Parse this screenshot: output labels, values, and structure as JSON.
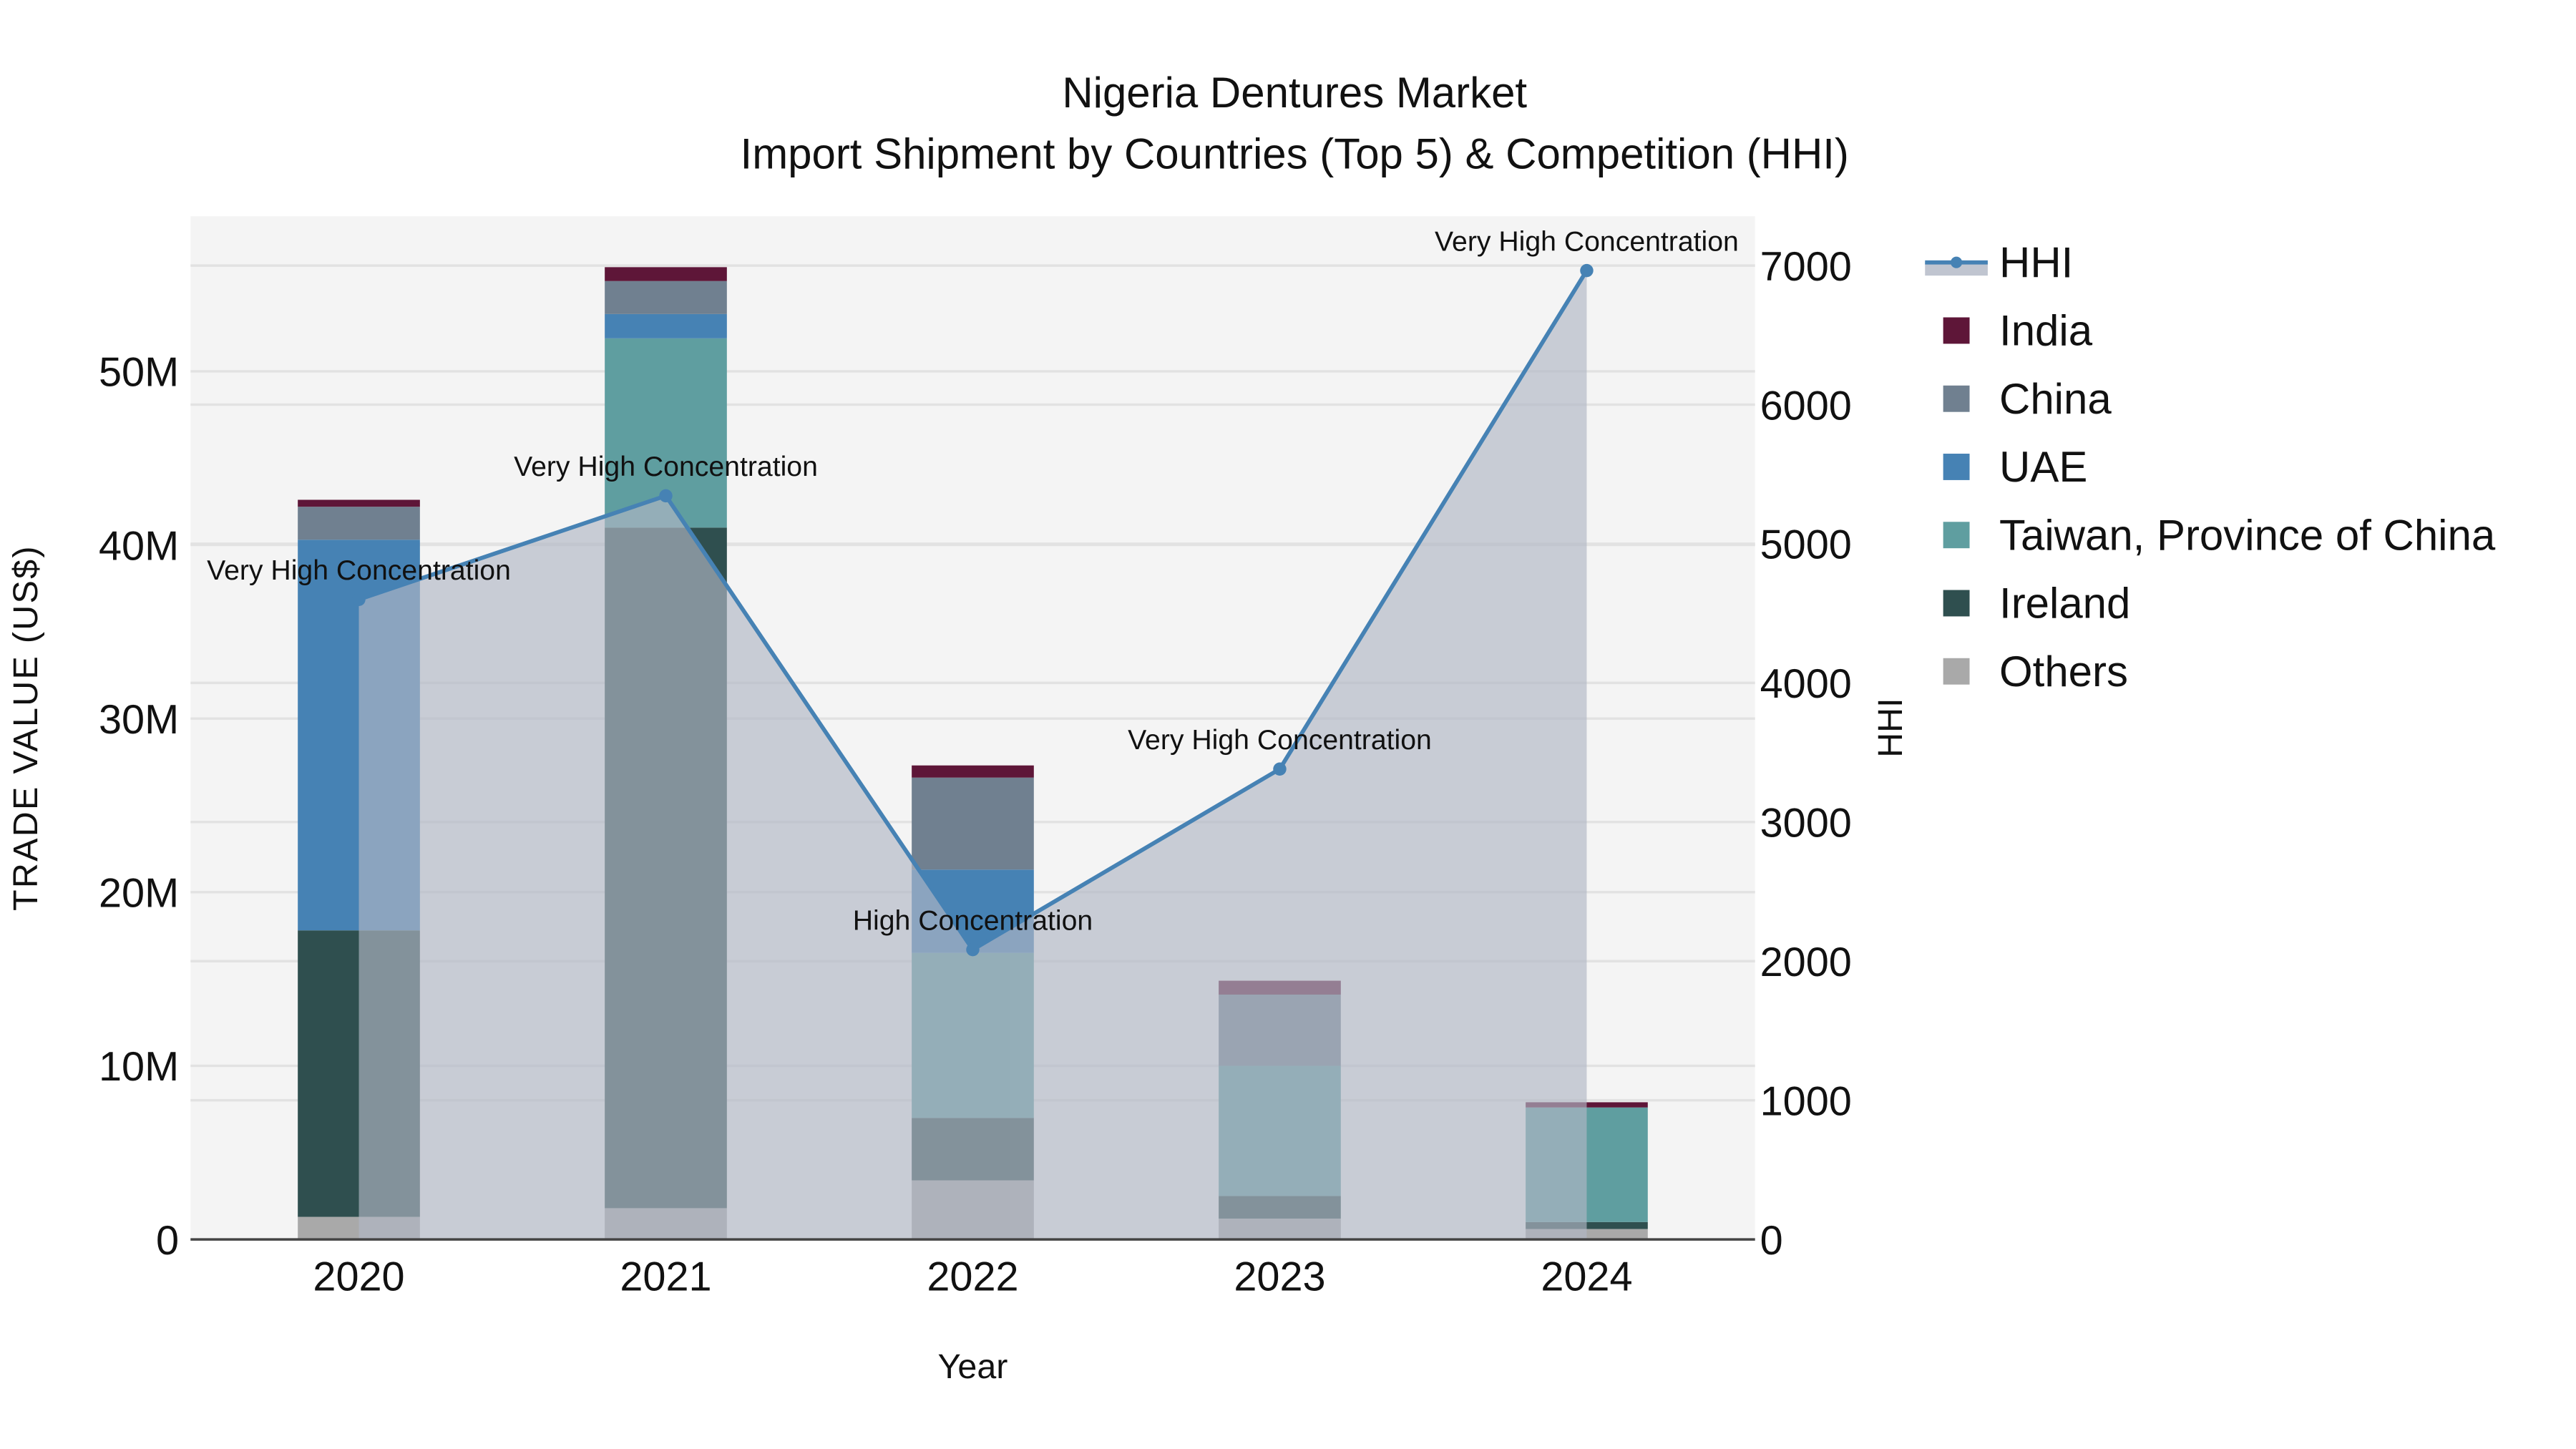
{
  "chart_data": {
    "type": "bar",
    "title": "Nigeria Dentures Market",
    "subtitle": "Import Shipment by Countries (Top 5) & Competition (HHI)",
    "xlabel": "Year",
    "ylabel": "TRADE VALUE (US$)",
    "y2label": "HHI",
    "categories": [
      "2020",
      "2021",
      "2022",
      "2023",
      "2024"
    ],
    "ylim": [
      0,
      58.8
    ],
    "y_unit": "M",
    "y_ticks": [
      0,
      10,
      20,
      30,
      40,
      50
    ],
    "y_tick_labels": [
      "0",
      "10M",
      "20M",
      "30M",
      "40M",
      "50M"
    ],
    "y2lim": [
      0,
      7350
    ],
    "y2_ticks": [
      0,
      1000,
      2000,
      3000,
      4000,
      5000,
      6000,
      7000
    ],
    "y2_tick_labels": [
      "0",
      "1000",
      "2000",
      "3000",
      "4000",
      "5000",
      "6000",
      "7000"
    ],
    "grid": true,
    "legend_position": "right",
    "series": [
      {
        "name": "Others",
        "color": "#a9a9a9",
        "values": [
          1.3,
          1.8,
          3.4,
          1.2,
          0.6
        ]
      },
      {
        "name": "Ireland",
        "color": "#2f4f4f",
        "values": [
          16.5,
          39.2,
          3.6,
          1.3,
          0.4
        ]
      },
      {
        "name": "Taiwan, Province of China",
        "color": "#5f9ea0",
        "values": [
          0,
          10.9,
          9.5,
          7.5,
          6.6
        ]
      },
      {
        "name": "UAE",
        "color": "#4682b4",
        "values": [
          22.5,
          1.4,
          4.8,
          0,
          0
        ]
      },
      {
        "name": "China",
        "color": "#708090",
        "values": [
          1.9,
          1.9,
          5.3,
          4.1,
          0
        ]
      },
      {
        "name": "India",
        "color": "#5e1638",
        "values": [
          0.4,
          0.8,
          0.7,
          0.8,
          0.3
        ]
      }
    ],
    "hhi": {
      "name": "HHI",
      "color": "#4682b4",
      "values": [
        4600,
        5345,
        2083,
        3381,
        6964
      ],
      "labels": [
        "Very High Concentration",
        "Very High Concentration",
        "High Concentration",
        "Very High Concentration",
        "Very High Concentration"
      ]
    },
    "legend": [
      "HHI",
      "India",
      "China",
      "UAE",
      "Taiwan, Province of China",
      "Ireland",
      "Others"
    ]
  }
}
